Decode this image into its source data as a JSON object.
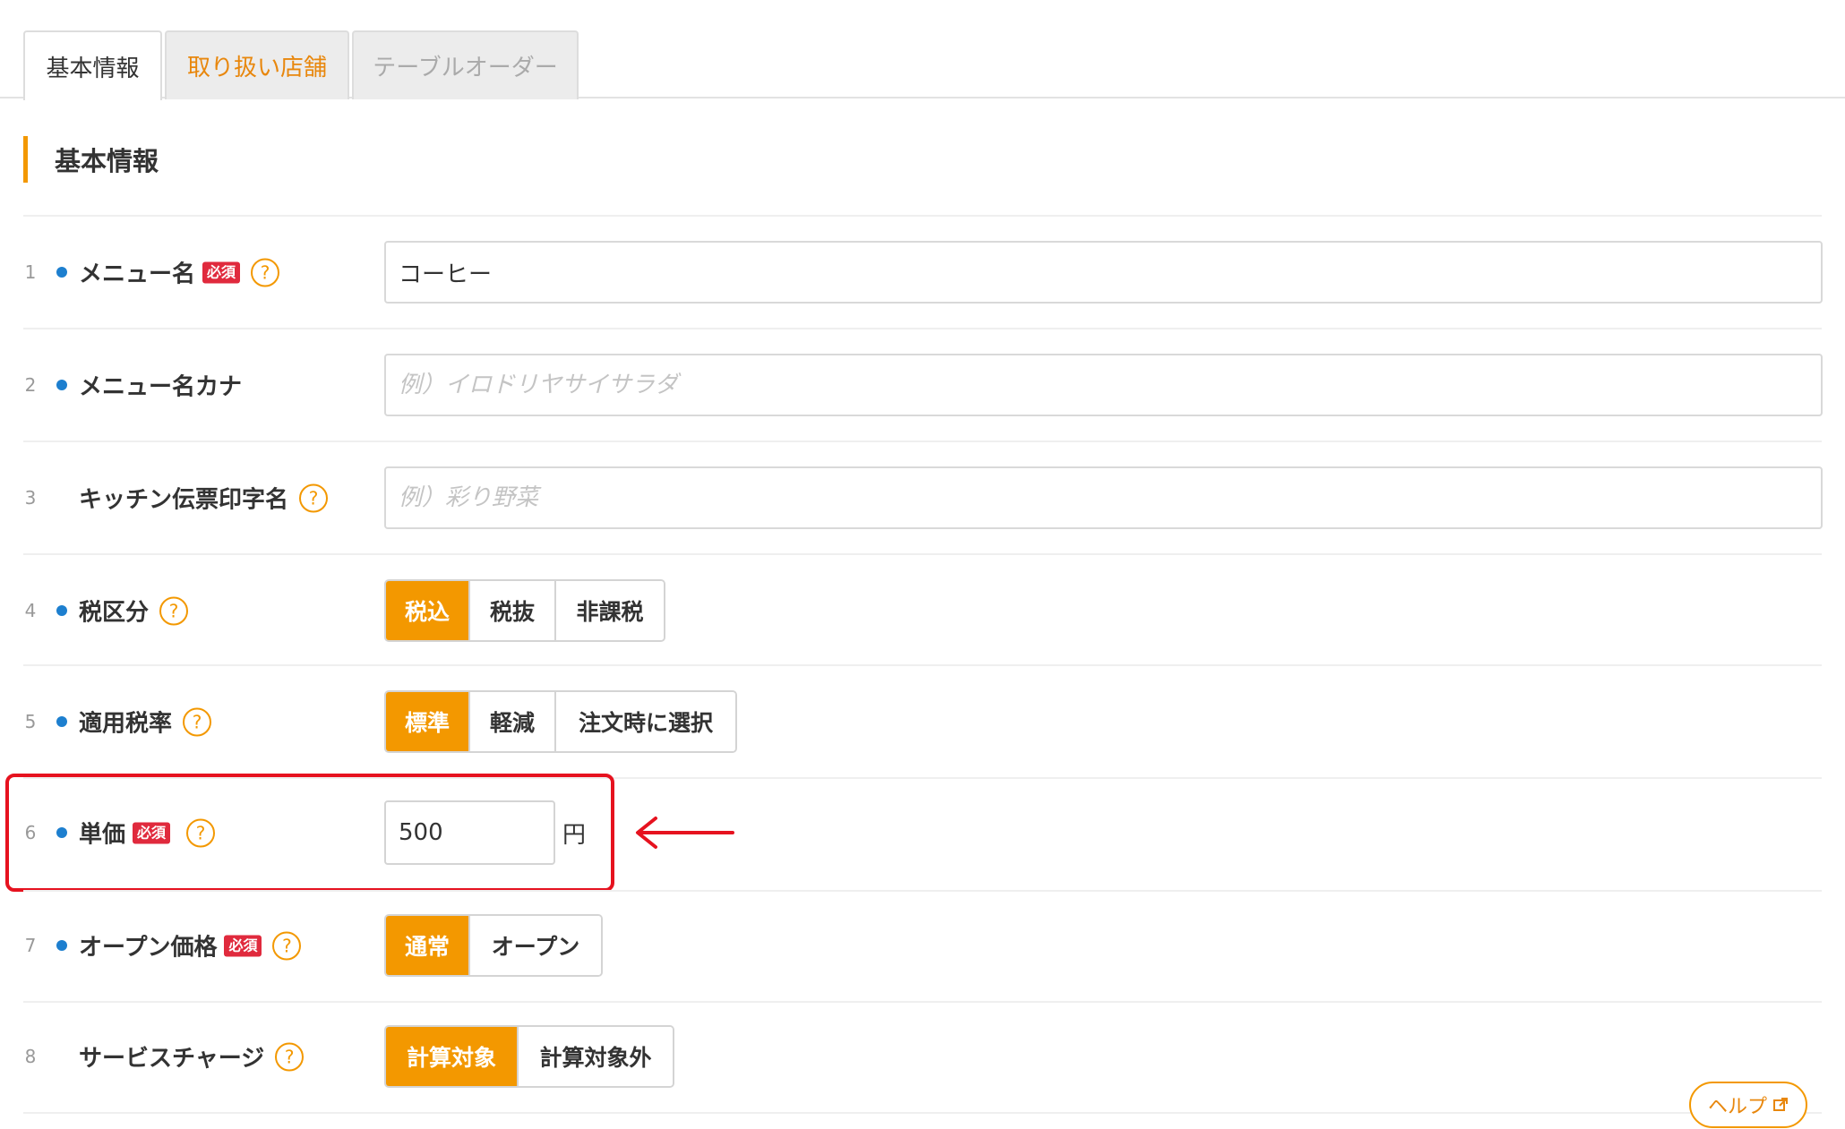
{
  "tabs": [
    {
      "label": "基本情報",
      "active": true
    },
    {
      "label": "取り扱い店舗",
      "active": false
    },
    {
      "label": "テーブルオーダー",
      "active": false
    }
  ],
  "section": {
    "title": "基本情報"
  },
  "required_badge": "必須",
  "help_glyph": "?",
  "rows": [
    {
      "num": "1",
      "label": "メニュー名",
      "required": true,
      "help": true,
      "dot": true,
      "value": "コーヒー",
      "placeholder": ""
    },
    {
      "num": "2",
      "label": "メニュー名カナ",
      "required": false,
      "help": false,
      "dot": true,
      "value": "",
      "placeholder": "例）イロドリヤサイサラダ"
    },
    {
      "num": "3",
      "label": "キッチン伝票印字名",
      "required": false,
      "help": true,
      "dot": false,
      "value": "",
      "placeholder": "例）彩り野菜"
    },
    {
      "num": "4",
      "label": "税区分",
      "required": false,
      "help": true,
      "dot": true,
      "options": [
        "税込",
        "税抜",
        "非課税"
      ],
      "selected": "税込"
    },
    {
      "num": "5",
      "label": "適用税率",
      "required": false,
      "help": true,
      "dot": true,
      "options": [
        "標準",
        "軽減",
        "注文時に選択"
      ],
      "selected": "標準"
    },
    {
      "num": "6",
      "label": "単価",
      "required": true,
      "help": true,
      "dot": true,
      "value": "500",
      "unit": "円"
    },
    {
      "num": "7",
      "label": "オープン価格",
      "required": true,
      "help": true,
      "dot": true,
      "options": [
        "通常",
        "オープン"
      ],
      "selected": "通常"
    },
    {
      "num": "8",
      "label": "サービスチャージ",
      "required": false,
      "help": true,
      "dot": false,
      "options": [
        "計算対象",
        "計算対象外"
      ],
      "selected": "計算対象"
    }
  ],
  "help_link": {
    "label": "ヘルプ",
    "icon": "external-link-icon"
  },
  "colors": {
    "accent": "#f39800",
    "required": "#e02a3d",
    "dot": "#1d7fcf",
    "highlight": "#e6121f"
  }
}
